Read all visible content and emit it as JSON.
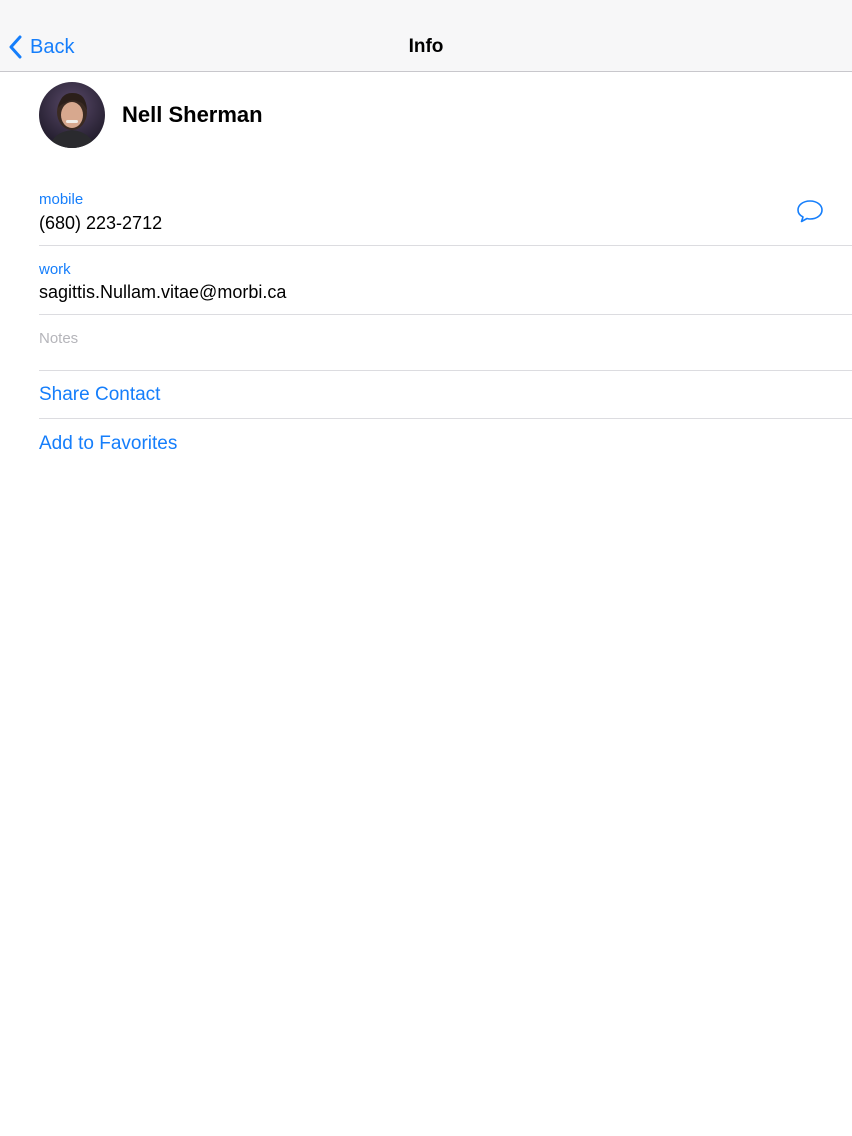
{
  "nav": {
    "back_label": "Back",
    "title": "Info",
    "back_icon": "chevron-left-icon"
  },
  "contact": {
    "name": "Nell Sherman",
    "avatar_icon": "contact-photo"
  },
  "fields": [
    {
      "label": "mobile",
      "value": "(680) 223-2712",
      "action_icon": "message-bubble-icon"
    },
    {
      "label": "work",
      "value": "sagittis.Nullam.vitae@morbi.ca"
    }
  ],
  "notes": {
    "placeholder": "Notes"
  },
  "actions": {
    "share": "Share Contact",
    "favorites": "Add to Favorites"
  },
  "colors": {
    "accent": "#157efb",
    "nav_background": "#f7f7f8",
    "separator": "#dcdce0",
    "placeholder_text": "#b5b5ba"
  }
}
